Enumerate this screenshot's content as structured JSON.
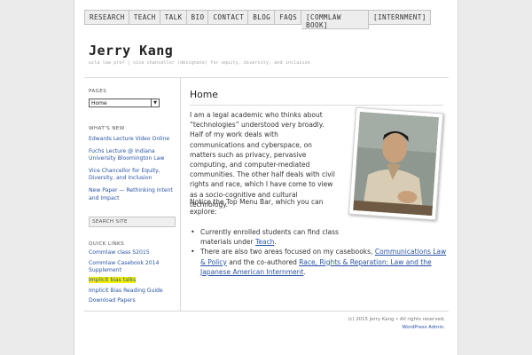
{
  "nav": {
    "tabs": [
      {
        "label": "RESEARCH"
      },
      {
        "label": "TEACH"
      },
      {
        "label": "TALK"
      },
      {
        "label": "BIO"
      },
      {
        "label": "CONTACT"
      },
      {
        "label": "BLOG"
      },
      {
        "label": "FAQS"
      },
      {
        "label": "[COMMLAW BOOK]"
      },
      {
        "label": "[INTERNMENT]"
      }
    ]
  },
  "header": {
    "title": "Jerry Kang",
    "tagline": "ucla law prof | vice chancellor (designate) for equity, diversity, and inclusion"
  },
  "sidebar": {
    "pages_heading": "Pages",
    "pages_selected": "Home",
    "whats_new_heading": "What's new",
    "news": [
      "Edwards Lecture Video Online",
      "Fuchs Lecture @ Indiana University Bloomington Law",
      "Vice Chancellor for Equity, Diversity, and Inclusion",
      "New Paper — Rethinking Intent and Impact"
    ],
    "search_label": "SEARCH SITE",
    "quick_heading": "Quick links",
    "quick_links": [
      {
        "label": "Commlaw class S2015",
        "highlight": false
      },
      {
        "label": "Commlaw Casebook 2014 Supplement",
        "highlight": false
      },
      {
        "label": "Implicit bias talks",
        "highlight": true
      },
      {
        "label": "Implicit Bias Reading Guide",
        "highlight": false
      },
      {
        "label": "Download Papers",
        "highlight": false
      }
    ]
  },
  "main": {
    "heading": "Home",
    "p1": "I am a legal academic who thinks about “technologies” understood very broadly. Half of my work deals with communications and cyberspace, on matters such as privacy, pervasive computing, and computer-mediated communities. The other half deals with civil rights and race, which I have come to view as a socio-cognitive and cultural technology.",
    "p2": "Notice the Top Menu Bar, which you can explore:",
    "b1_pre": "Currently enrolled students can find class materials under ",
    "b1_link": "Teach",
    "b1_post": ".",
    "b2_pre": "There are also two areas focused on my casebooks, ",
    "b2_link1": "Communications Law & Policy",
    "b2_mid": " and the co-authored ",
    "b2_link2": "Race, Rights & Reparation: Law and the Japanese American Internment",
    "b2_post": "."
  },
  "footer": {
    "copyright": "(c) 2015 Jerry Kang • All rights reserved.",
    "admin": "WordPress Admin."
  }
}
